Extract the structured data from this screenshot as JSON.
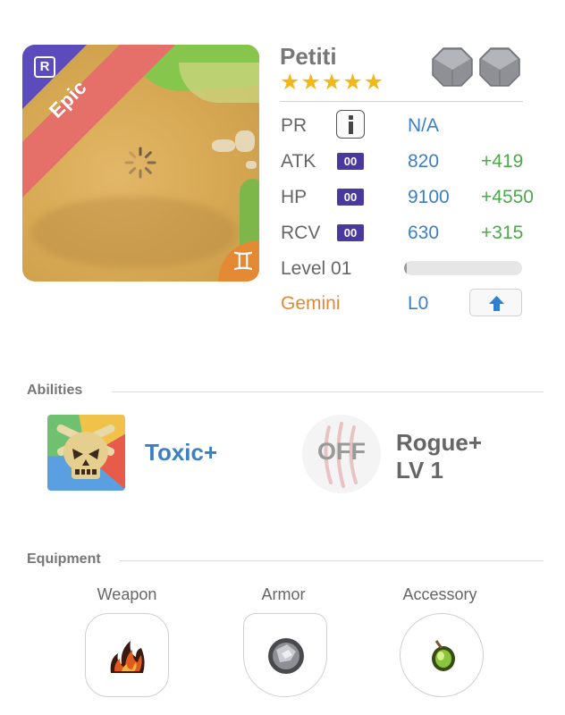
{
  "unit": {
    "name": "Petiti",
    "stars": "★★★★★",
    "rarity": "Epic",
    "rarity_badge": "R",
    "sign_icon": "gemini-icon",
    "sign_symbol": "♊",
    "awakening_icons": [
      "octagon-stone-icon",
      "octagon-stone-icon"
    ]
  },
  "stats": {
    "pr": {
      "label": "PR",
      "value": "N/A"
    },
    "atk": {
      "label": "ATK",
      "badge": "00",
      "value": "820",
      "bonus": "+419"
    },
    "hp": {
      "label": "HP",
      "badge": "00",
      "value": "9100",
      "bonus": "+4550"
    },
    "rcv": {
      "label": "RCV",
      "badge": "00",
      "value": "630",
      "bonus": "+315"
    },
    "level": {
      "label": "Level 01",
      "progress": 0.02
    },
    "sign": {
      "label": "Gemini",
      "value": "L0"
    }
  },
  "abilities": {
    "title": "Abilities",
    "first": {
      "name": "Toxic+",
      "icon": "skull-icon"
    },
    "second": {
      "status": "OFF",
      "name": "Rogue+",
      "level": "LV 1",
      "icon": "claw-icon"
    }
  },
  "equipment": {
    "title": "Equipment",
    "weapon": {
      "label": "Weapon",
      "icon": "flame-icon"
    },
    "armor": {
      "label": "Armor",
      "icon": "stone-shield-icon"
    },
    "accessory": {
      "label": "Accessory",
      "icon": "green-gem-icon"
    }
  },
  "colors": {
    "rarity_ribbon": "#e5706a",
    "rarity_corner": "#5b4bbd",
    "value_blue": "#3b7fc4",
    "bonus_green": "#4fa84b",
    "sign_orange": "#e08a36",
    "star_gold": "#f2b81a",
    "stat_badge": "#4a3a9e"
  }
}
